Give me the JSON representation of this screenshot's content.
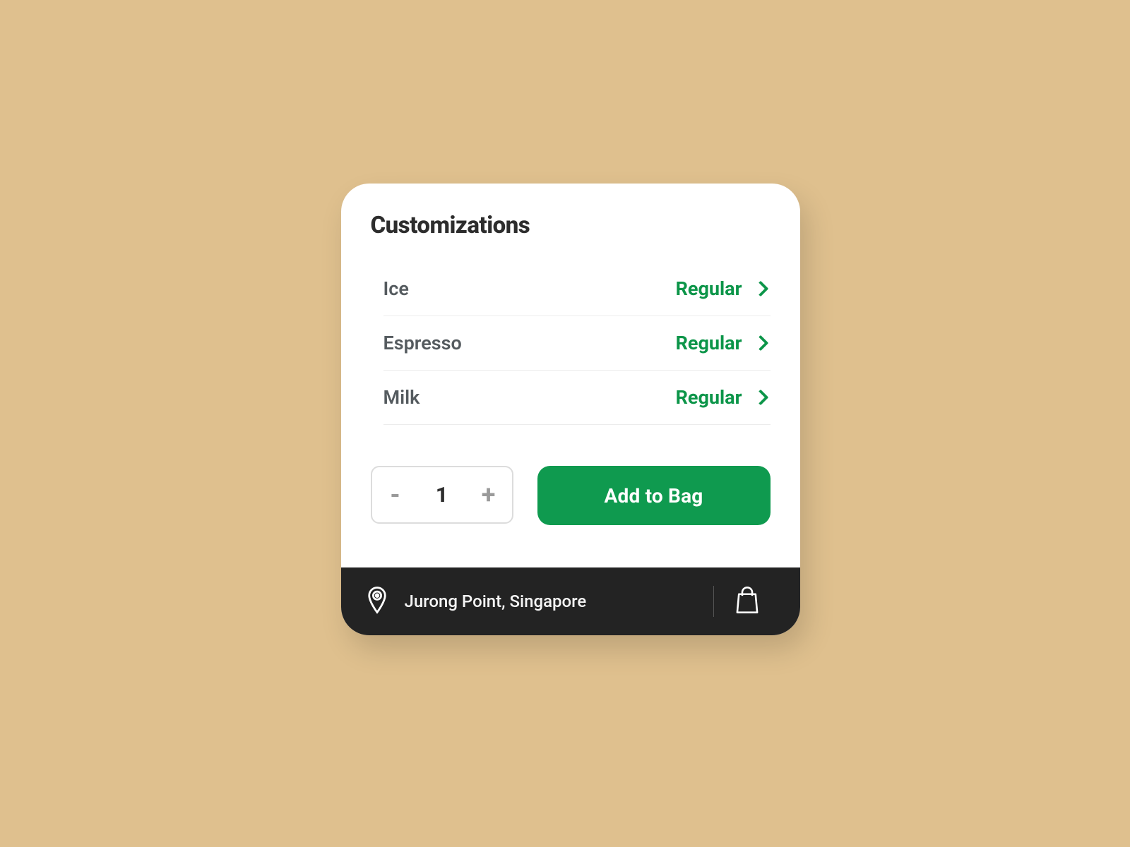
{
  "heading": "Customizations",
  "customizations": [
    {
      "label": "Ice",
      "value": "Regular"
    },
    {
      "label": "Espresso",
      "value": "Regular"
    },
    {
      "label": "Milk",
      "value": "Regular"
    }
  ],
  "quantity": {
    "minus": "-",
    "value": "1",
    "plus": "+"
  },
  "add_button": "Add to Bag",
  "footer": {
    "location": "Jurong Point, Singapore"
  },
  "colors": {
    "accent": "#0f9a4f",
    "background": "#dfc08e"
  }
}
